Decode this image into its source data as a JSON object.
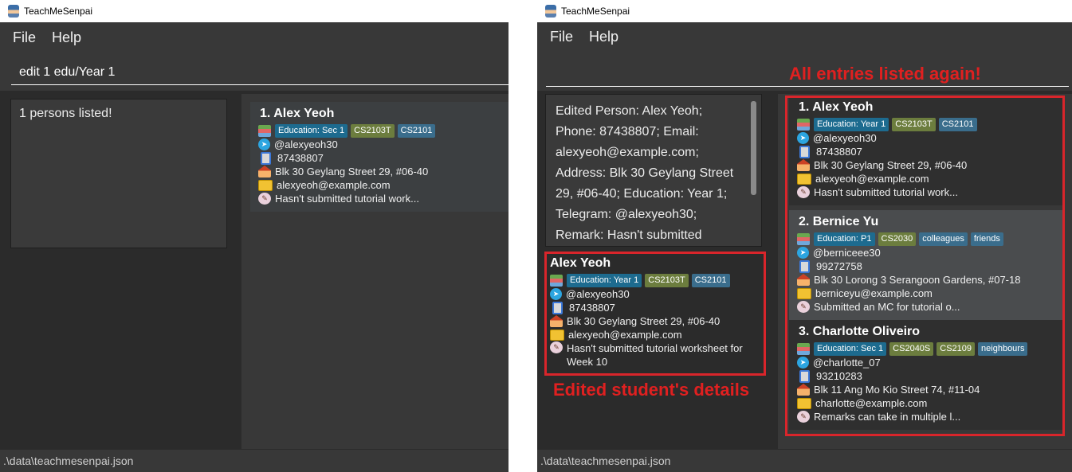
{
  "left": {
    "app_title": "TeachMeSenpai",
    "menu": [
      "File",
      "Help"
    ],
    "command": "edit 1 edu/Year 1",
    "result": "1 persons listed!",
    "persons": [
      {
        "index": "1.",
        "name": "Alex Yeoh",
        "tags": [
          "Education: Sec 1",
          "CS2103T",
          "CS2101"
        ],
        "telegram": "@alexyeoh30",
        "phone": "87438807",
        "address": "Blk 30 Geylang Street 29, #06-40",
        "email": "alexyeoh@example.com",
        "remark": "Hasn't submitted tutorial work..."
      }
    ],
    "status": ".\\data\\teachmesenpai.json"
  },
  "right": {
    "app_title": "TeachMeSenpai",
    "menu": [
      "File",
      "Help"
    ],
    "result": "Edited Person: Alex Yeoh; Phone: 87438807; Email: alexyeoh@example.com; Address: Blk 30 Geylang Street 29, #06-40; Education: Year 1; Telegram: @alexyeoh30; Remark: Hasn't submitted",
    "detail": {
      "name": "Alex Yeoh",
      "tags": [
        "Education: Year 1",
        "CS2103T",
        "CS2101"
      ],
      "telegram": "@alexyeoh30",
      "phone": "87438807",
      "address": "Blk 30 Geylang Street 29, #06-40",
      "email": "alexyeoh@example.com",
      "remark": "Hasn't submitted tutorial worksheet for Week 10"
    },
    "persons": [
      {
        "index": "1.",
        "name": "Alex Yeoh",
        "tags": [
          "Education: Year 1",
          "CS2103T",
          "CS2101"
        ],
        "telegram": "@alexyeoh30",
        "phone": "87438807",
        "address": "Blk 30 Geylang Street 29, #06-40",
        "email": "alexyeoh@example.com",
        "remark": "Hasn't submitted tutorial work..."
      },
      {
        "index": "2.",
        "name": "Bernice Yu",
        "tags": [
          "Education: P1",
          "CS2030",
          "colleagues",
          "friends"
        ],
        "telegram": "@berniceee30",
        "phone": "99272758",
        "address": "Blk 30 Lorong 3 Serangoon Gardens, #07-18",
        "email": "berniceyu@example.com",
        "remark": "Submitted an MC for tutorial o..."
      },
      {
        "index": "3.",
        "name": "Charlotte Oliveiro",
        "tags": [
          "Education: Sec 1",
          "CS2040S",
          "CS2109",
          "neighbours"
        ],
        "telegram": "@charlotte_07",
        "phone": "93210283",
        "address": "Blk 11 Ang Mo Kio Street 74, #11-04",
        "email": "charlotte@example.com",
        "remark": "Remarks can take in multiple l..."
      }
    ],
    "status": ".\\data\\teachmesenpai.json",
    "annotation_list": "All entries listed again!",
    "annotation_detail": "Edited student's details"
  },
  "colors": {
    "accent_red": "#d9252b",
    "bg": "#2b2b2b",
    "tag_edu": "#1d6b8f",
    "tag_module": "#6c7d3e"
  }
}
